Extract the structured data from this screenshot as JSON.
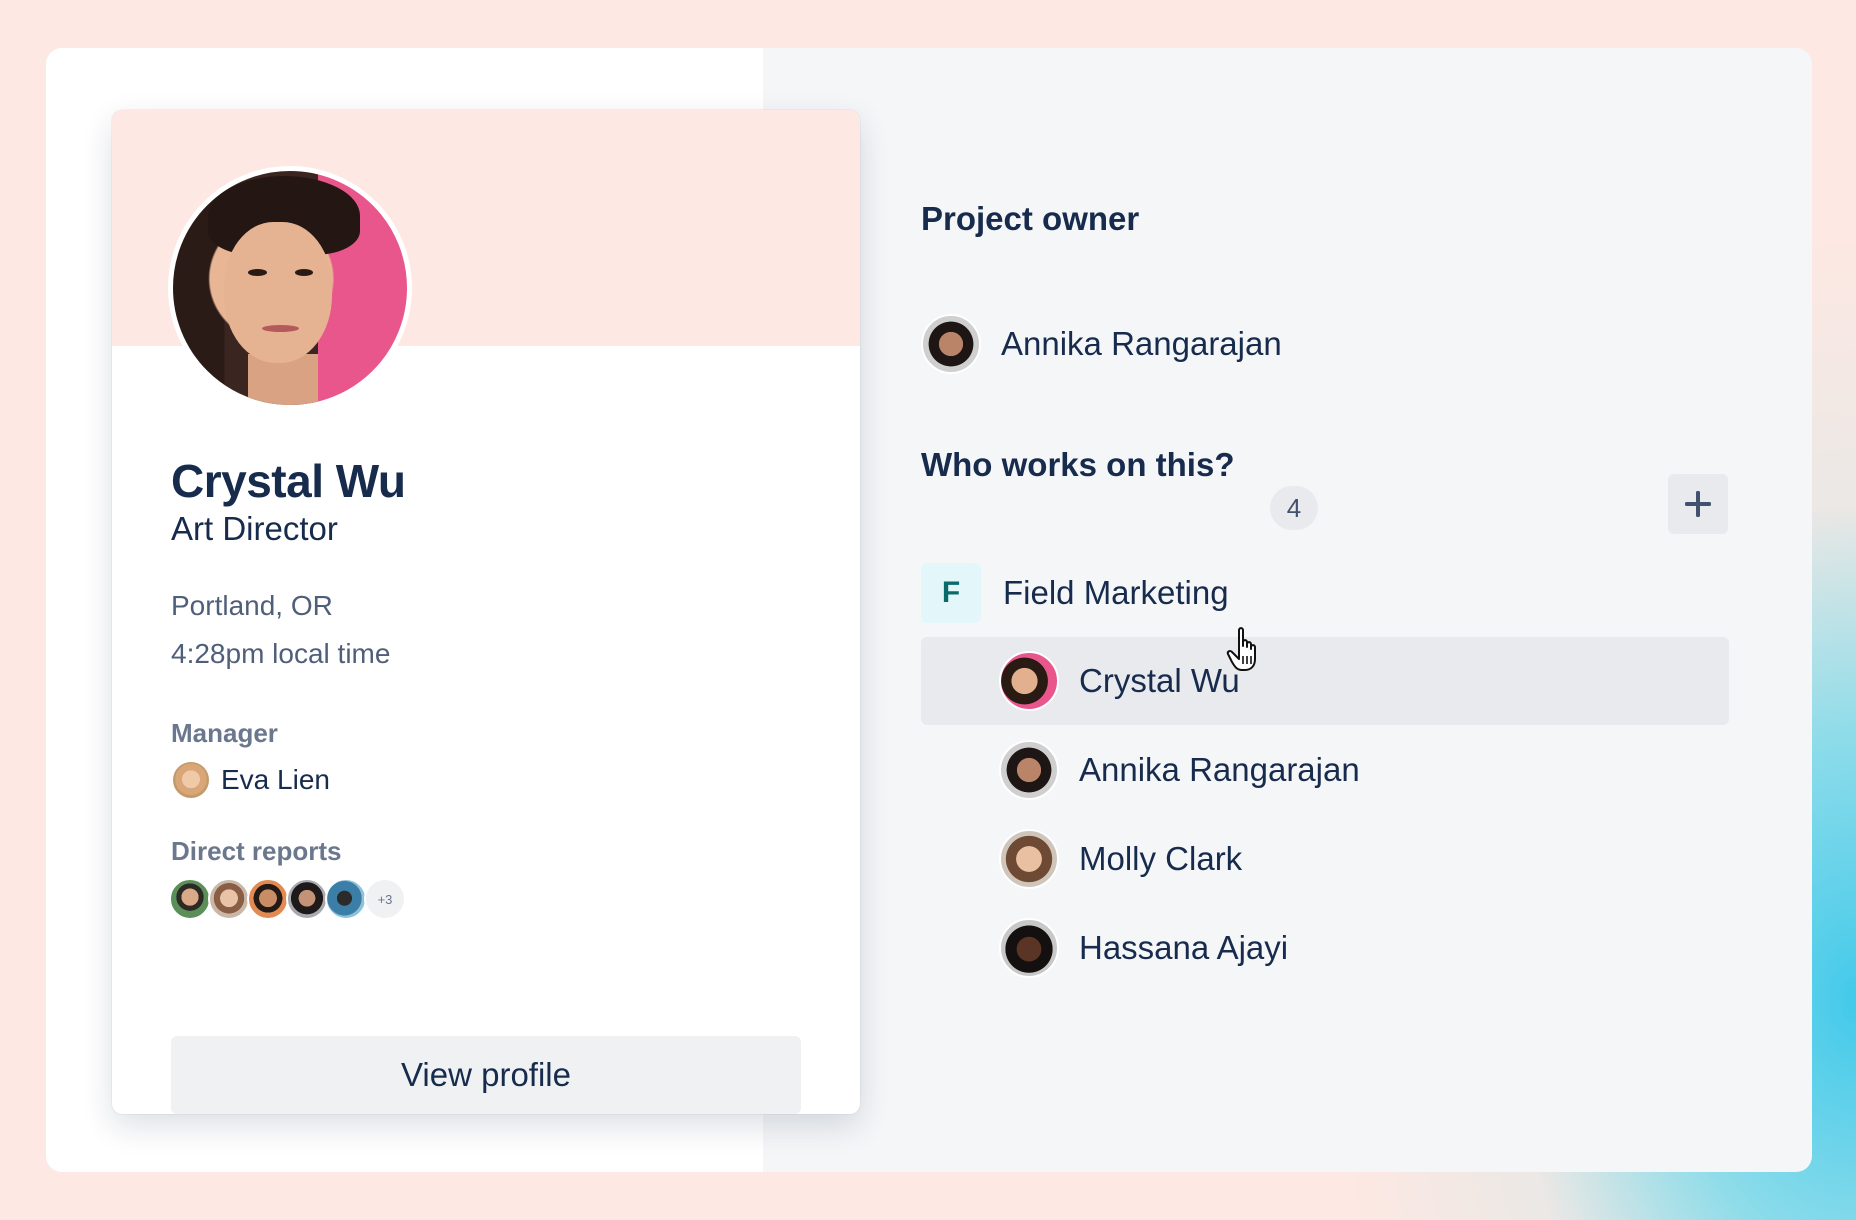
{
  "profile_card": {
    "name": "Crystal Wu",
    "title": "Art Director",
    "location": "Portland, OR",
    "local_time": "4:28pm local time",
    "manager_label": "Manager",
    "manager_name": "Eva Lien",
    "direct_reports_label": "Direct reports",
    "direct_reports_more": "+3",
    "view_profile_label": "View profile"
  },
  "project_owner": {
    "heading": "Project owner",
    "name": "Annika Rangarajan"
  },
  "contributors": {
    "heading": "Who works on this?",
    "count": "4",
    "team": {
      "initial": "F",
      "name": "Field Marketing"
    },
    "members": [
      {
        "name": "Crystal Wu"
      },
      {
        "name": "Annika Rangarajan"
      },
      {
        "name": "Molly Clark"
      },
      {
        "name": "Hassana Ajayi"
      }
    ]
  },
  "colors": {
    "text_primary": "#172b4d",
    "text_secondary": "#505f79",
    "banner_pink": "#fde8e3",
    "team_icon_bg": "#e3f7fa",
    "team_icon_fg": "#0b6b6b",
    "hover_row": "#e9eaee"
  },
  "icons": {
    "add": "plus-icon",
    "cursor": "hand-pointer-cursor-icon"
  }
}
